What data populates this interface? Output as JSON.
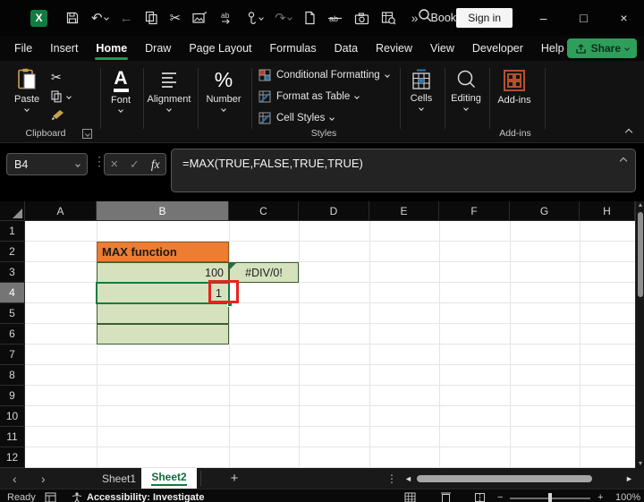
{
  "titlebar": {
    "workbook_name": "Book...",
    "sign_in": "Sign in"
  },
  "glyphs": {
    "undo": "↶",
    "redo": "↷",
    "back": "←",
    "cut": "✂",
    "overflow": "»",
    "minimize": "–",
    "maximize": "□",
    "close": "×",
    "dots": "⋮",
    "tab_prev": "‹",
    "tab_next": "›",
    "add_sheet": "+",
    "scroll_left": "◄",
    "scroll_right": "►",
    "scroll_up": "▲",
    "scroll_down": "▼",
    "zoom_out": "−",
    "zoom_in": "+",
    "cancel": "×",
    "enter": "✓",
    "font_letter": "A",
    "percent": "%"
  },
  "ribbon_tabs": {
    "items": [
      "File",
      "Insert",
      "Home",
      "Draw",
      "Page Layout",
      "Formulas",
      "Data",
      "Review",
      "View",
      "Developer",
      "Help"
    ],
    "active": "Home",
    "share": "Share"
  },
  "ribbon": {
    "paste": "Paste",
    "clipboard_group": "Clipboard",
    "font": "Font",
    "alignment": "Alignment",
    "number": "Number",
    "conditional_formatting": "Conditional Formatting",
    "format_as_table": "Format as Table",
    "cell_styles": "Cell Styles",
    "styles_group": "Styles",
    "cells": "Cells",
    "editing": "Editing",
    "addins": "Add-ins",
    "addins_group": "Add-ins"
  },
  "formula_bar": {
    "name_box": "B4",
    "fx": "fx",
    "formula": "=MAX(TRUE,FALSE,TRUE,TRUE)"
  },
  "grid": {
    "column_headers": [
      "A",
      "B",
      "C",
      "D",
      "E",
      "F",
      "G",
      "H"
    ],
    "row_headers": [
      "1",
      "2",
      "3",
      "4",
      "5",
      "6",
      "7",
      "8",
      "9",
      "10",
      "11",
      "12"
    ],
    "active_cell": "B4",
    "selected_column": "B",
    "selected_row": "4",
    "cells": {
      "B2": "MAX function",
      "B3": "100",
      "C3": "#DIV/0!",
      "B4": "1"
    },
    "colors": {
      "header_fill": "#ED7D31",
      "data_fill": "#D6E2BE",
      "cell_border": "#3E5C2E",
      "selection": "#107C41",
      "annotation_box": "#E8231D",
      "error_indicator": "#1E7145"
    }
  },
  "sheet_tabs": {
    "sheet1": "Sheet1",
    "sheet2": "Sheet2",
    "active": "Sheet2"
  },
  "status_bar": {
    "ready": "Ready",
    "accessibility": "Accessibility: Investigate",
    "zoom": "100%"
  }
}
